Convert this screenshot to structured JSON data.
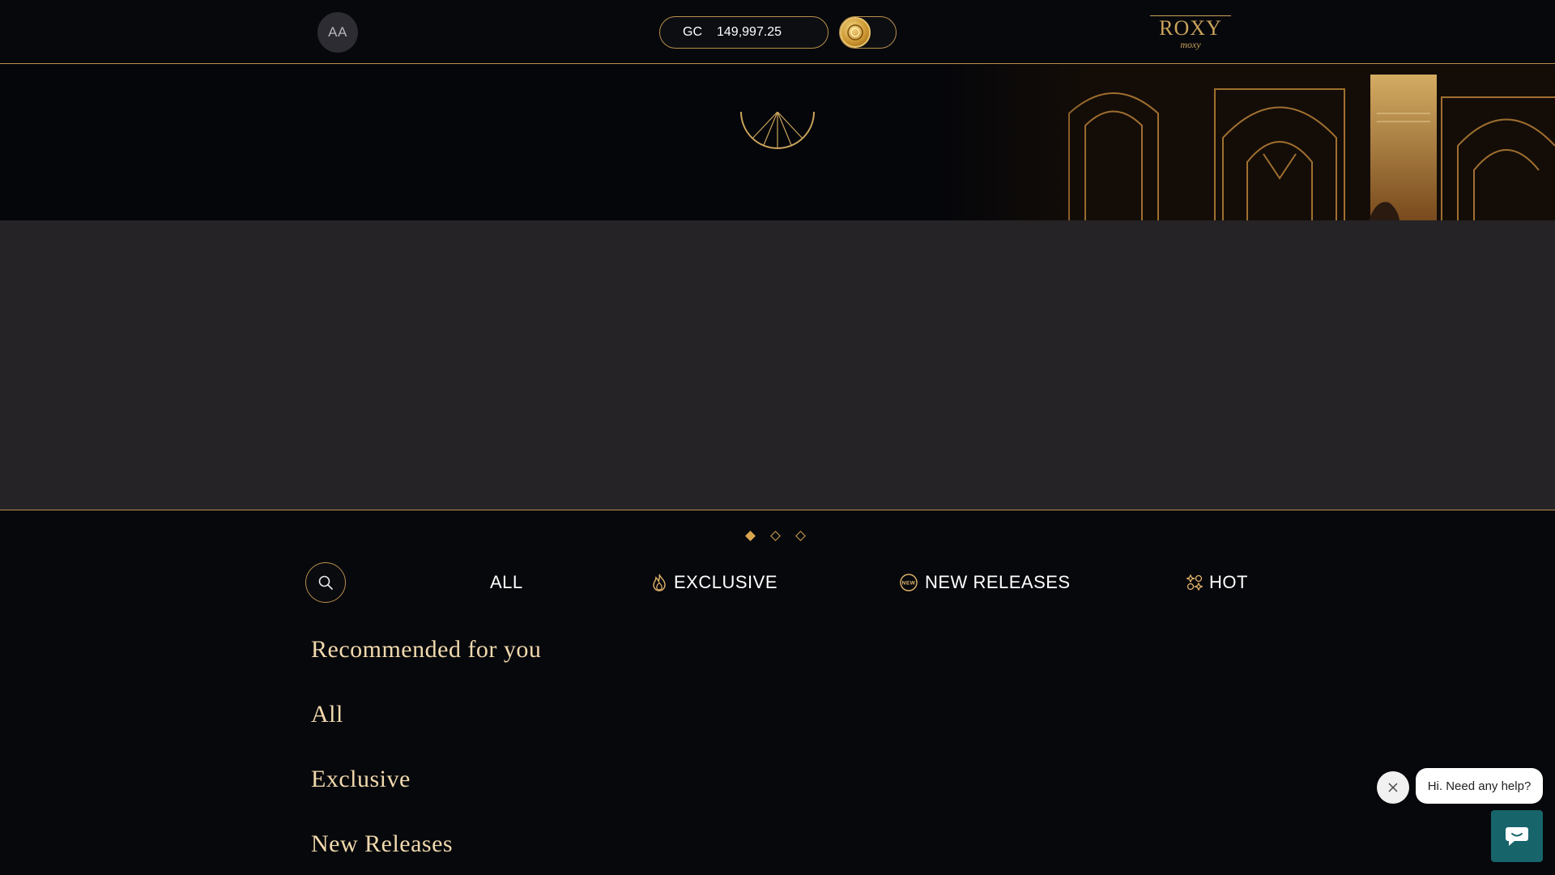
{
  "header": {
    "avatar_initials": "AA",
    "balance": {
      "currency": "GC",
      "amount": "149,997.25"
    },
    "logo": {
      "top": "ROXY",
      "bottom": "moxy"
    }
  },
  "carousel": {
    "slide_count": 3,
    "active_index": 0
  },
  "tabs": [
    {
      "label": "ALL",
      "icon": "none"
    },
    {
      "label": "EXCLUSIVE",
      "icon": "flame-icon"
    },
    {
      "label": "NEW RELEASES",
      "icon": "new-badge-icon"
    },
    {
      "label": "HOT",
      "icon": "grid-star-icon"
    }
  ],
  "sections": [
    "Recommended for you",
    "All",
    "Exclusive",
    "New Releases"
  ],
  "chat": {
    "message": "Hi. Need any help?"
  },
  "colors": {
    "gold": "#b98f4c",
    "title_gold": "#f1d9ad",
    "background": "#07080c",
    "panel": "#252326",
    "chat_teal": "#17646a"
  }
}
